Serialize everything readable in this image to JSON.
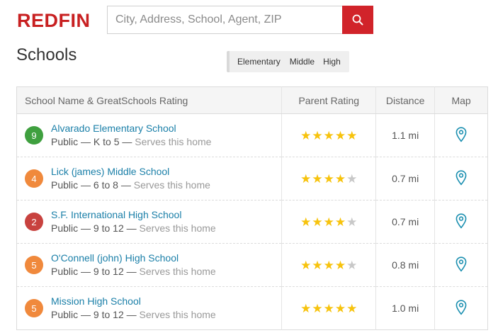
{
  "brand": {
    "logo_text": "REDFIN",
    "color": "#c82021"
  },
  "search": {
    "placeholder": "City, Address, School, Agent, ZIP",
    "value": "",
    "button_color": "#d1232a"
  },
  "page": {
    "title": "Schools"
  },
  "filters": [
    "Elementary",
    "Middle",
    "High"
  ],
  "table": {
    "headers": {
      "name": "School Name & GreatSchools Rating",
      "parent_rating": "Parent Rating",
      "distance": "Distance",
      "map": "Map"
    },
    "rows": [
      {
        "rating": "9",
        "badge_color": "#3fa03f",
        "name": "Alvarado Elementary School",
        "type": "Public",
        "sep1": " — ",
        "grades": "K to 5",
        "sep2": " — ",
        "serves": "Serves this home",
        "stars": 5,
        "distance": "1.1 mi"
      },
      {
        "rating": "4",
        "badge_color": "#f0893c",
        "name": "Lick (james) Middle School",
        "type": "Public",
        "sep1": " — ",
        "grades": "6 to 8",
        "sep2": " — ",
        "serves": "Serves this home",
        "stars": 4,
        "distance": "0.7 mi"
      },
      {
        "rating": "2",
        "badge_color": "#c8423f",
        "name": "S.F. International High School",
        "type": "Public",
        "sep1": " — ",
        "grades": "9 to 12",
        "sep2": " — ",
        "serves": "Serves this home",
        "stars": 4,
        "distance": "0.7 mi"
      },
      {
        "rating": "5",
        "badge_color": "#f0893c",
        "name": "O'Connell (john) High School",
        "type": "Public",
        "sep1": " — ",
        "grades": "9 to 12",
        "sep2": " — ",
        "serves": "Serves this home",
        "stars": 4,
        "distance": "0.8 mi"
      },
      {
        "rating": "5",
        "badge_color": "#f0893c",
        "name": "Mission High School",
        "type": "Public",
        "sep1": " — ",
        "grades": "9 to 12",
        "sep2": " — ",
        "serves": "Serves this home",
        "stars": 5,
        "distance": "1.0 mi"
      }
    ]
  },
  "colors": {
    "star_on": "#f7c30d",
    "star_off": "#c8c8c8",
    "link": "#1a7fa8",
    "map_pin": "#1a8fb0"
  },
  "icons": {
    "search_button": "search-icon",
    "map": "map-pin-icon"
  }
}
